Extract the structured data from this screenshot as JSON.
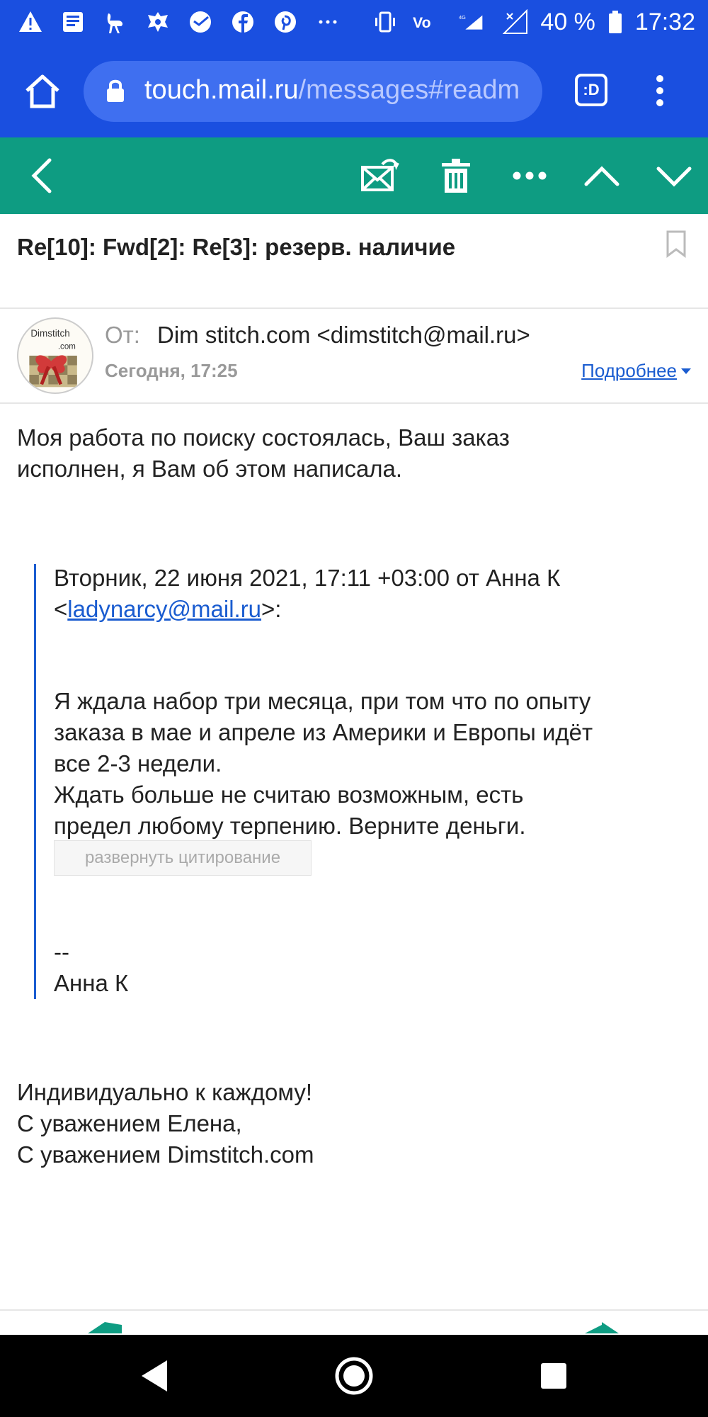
{
  "status_bar": {
    "battery": "40 %",
    "time": "17:32",
    "network": "4G"
  },
  "browser": {
    "url_host": "touch.mail.ru",
    "url_path": "/messages#readm",
    "tabs_label": ":D"
  },
  "message": {
    "subject": "Re[10]: Fwd[2]: Re[3]: резерв. наличие",
    "from_label": "От:",
    "from_value": "Dim stitch.com <dimstitch@mail.ru>",
    "date": "Сегодня, 17:25",
    "details_link": "Подробнее",
    "avatar_text": "Dimstitch.com",
    "body_line1": "Моя работа по поиску состоялась, Ваш заказ",
    "body_line2": "исполнен, я Вам об этом написала.",
    "quote_header_line1": "Вторник, 22 июня 2021, 17:11 +03:00 от Анна К",
    "quote_header_lt": "<",
    "quote_email": "ladynarcy@mail.ru",
    "quote_header_gt": ">:",
    "quote_line1": "Я ждала набор три месяца, при том что по опыту",
    "quote_line2": "заказа в мае и апреле из Америки и Европы идёт",
    "quote_line3": "все 2-3 недели.",
    "quote_line4": "Ждать больше не считаю возможным, есть",
    "quote_line5": "предел любому терпению. Верните деньги.",
    "expand_quote": "развернуть цитирование",
    "sig_dash": "--",
    "sig_name": "Анна К",
    "closing_line1": "Индивидуально к каждому!",
    "closing_line2": "С уважением Елена,",
    "closing_line3": "С уважением Dimstitch.com"
  },
  "colors": {
    "browser_bar": "#1a4fe0",
    "mail_toolbar": "#0e9c82",
    "link": "#1a5cd0"
  }
}
